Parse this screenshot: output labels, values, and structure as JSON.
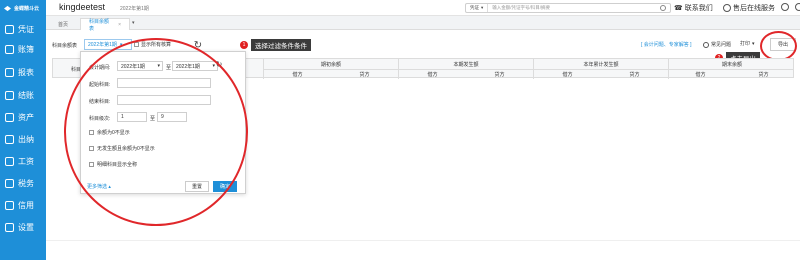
{
  "brand": {
    "name": "金蝶精斗云"
  },
  "sidebar": {
    "items": [
      {
        "label": "凭证",
        "icon": "voucher-icon"
      },
      {
        "label": "账簿",
        "icon": "ledger-icon"
      },
      {
        "label": "报表",
        "icon": "report-icon"
      },
      {
        "label": "结账",
        "icon": "closing-icon"
      },
      {
        "label": "资产",
        "icon": "asset-icon"
      },
      {
        "label": "出纳",
        "icon": "cashier-icon"
      },
      {
        "label": "工资",
        "icon": "salary-icon"
      },
      {
        "label": "税务",
        "icon": "tax-icon"
      },
      {
        "label": "信用",
        "icon": "credit-icon"
      },
      {
        "label": "设置",
        "icon": "settings-icon"
      }
    ]
  },
  "header": {
    "company": "kingdeetest",
    "period": "2022年第1期",
    "search": {
      "scope": "凭证",
      "placeholder": "输入金额/凭证字号/科目/摘要"
    },
    "contact": "联系我们",
    "service": "售后在线服务"
  },
  "tabs": {
    "home": "首页",
    "active": "科目余额表",
    "close": "×",
    "more": "▾"
  },
  "toolbar": {
    "label": "科目余额表",
    "period_value": "2022年第1期",
    "show_all_label": "显示所有核算",
    "links": "[ 会计问题、专家解答 ]",
    "help": "常见问题",
    "print": "打印",
    "export": "导出"
  },
  "callouts": [
    {
      "num": "1",
      "text": "选择过滤条件条件"
    },
    {
      "num": "2",
      "text": "点击导出"
    }
  ],
  "grid": {
    "first_col": "科目",
    "groups": [
      "期初余额",
      "本期发生额",
      "本年累计发生额",
      "期末余额"
    ],
    "sub": [
      "借方",
      "贷方"
    ]
  },
  "filter": {
    "period_label": "会计期间:",
    "period_from": "2022年1期",
    "period_to": "2022年1期",
    "to_sep": "至",
    "start_subject_label": "起始科目:",
    "end_subject_label": "结束科目:",
    "level_label": "科目级次:",
    "level_from": "1",
    "level_to": "9",
    "options": [
      "余额为0不显示",
      "无发生额且余额为0不显示",
      "明细科目显示全称"
    ],
    "more": "更多筛选 ▴",
    "reset": "重置",
    "ok": "确定"
  },
  "colors": {
    "accent": "#1e8fd8",
    "ring": "#e0272a",
    "callout_bg": "#3b3b3b"
  }
}
